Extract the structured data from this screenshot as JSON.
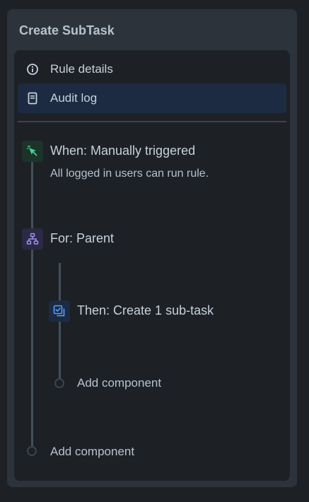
{
  "panel": {
    "title": "Create SubTask"
  },
  "menu": {
    "items": [
      {
        "label": "Rule details",
        "icon": "info-icon",
        "selected": false
      },
      {
        "label": "Audit log",
        "icon": "document-icon",
        "selected": true
      }
    ]
  },
  "flow": {
    "trigger": {
      "title": "When: Manually triggered",
      "subtitle": "All logged in users can run rule.",
      "icon": "cursor-click-icon",
      "color": "#4bce97"
    },
    "branch": {
      "title": "For: Parent",
      "icon": "hierarchy-icon",
      "color": "#9f8fef"
    },
    "action": {
      "title": "Then: Create 1 sub-task",
      "icon": "subtask-icon",
      "color": "#579dff"
    },
    "add_component_inner": "Add component",
    "add_component_outer": "Add component"
  }
}
